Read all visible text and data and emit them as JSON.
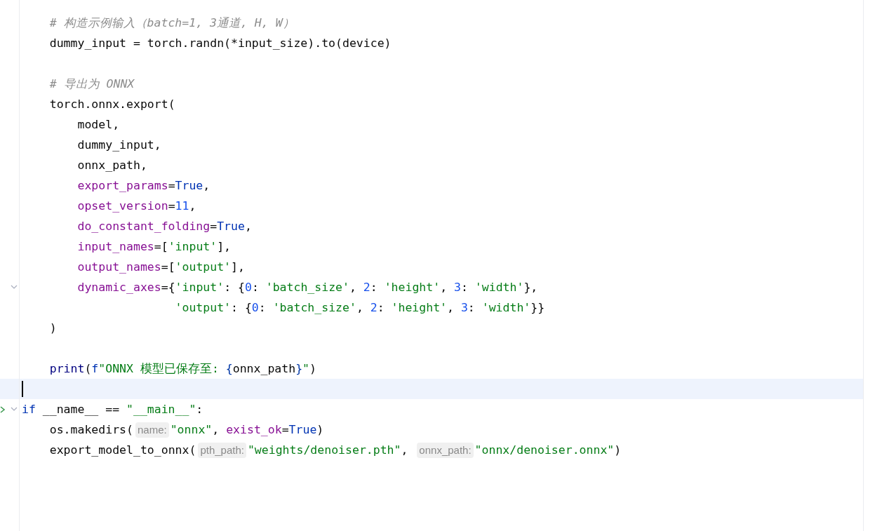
{
  "lines": [
    {
      "fold": false,
      "run": false,
      "current": false,
      "tokens": [
        {
          "kind": "comment",
          "text": "    # 构造示例输入（batch=1, 3通道, H, W）"
        }
      ]
    },
    {
      "fold": false,
      "run": false,
      "current": false,
      "tokens": [
        {
          "kind": "plain",
          "text": "    dummy_input = torch.randn(*input_size).to(device)"
        }
      ]
    },
    {
      "fold": false,
      "run": false,
      "current": false
    },
    {
      "fold": false,
      "run": false,
      "current": false,
      "tokens": [
        {
          "kind": "comment",
          "text": "    # 导出为 ONNX"
        }
      ]
    },
    {
      "fold": false,
      "run": false,
      "current": false,
      "tokens": [
        {
          "kind": "plain",
          "text": "    torch.onnx.export("
        }
      ]
    },
    {
      "fold": false,
      "run": false,
      "current": false,
      "tokens": [
        {
          "kind": "plain",
          "text": "        model,"
        }
      ]
    },
    {
      "fold": false,
      "run": false,
      "current": false,
      "tokens": [
        {
          "kind": "plain",
          "text": "        dummy_input,"
        }
      ]
    },
    {
      "fold": false,
      "run": false,
      "current": false,
      "tokens": [
        {
          "kind": "plain",
          "text": "        onnx_path,"
        }
      ]
    },
    {
      "fold": false,
      "run": false,
      "current": false,
      "tokens": [
        {
          "kind": "param",
          "text": "        export_params"
        },
        {
          "kind": "plain",
          "text": "="
        },
        {
          "kind": "keyword",
          "text": "True"
        },
        {
          "kind": "plain",
          "text": ","
        }
      ]
    },
    {
      "fold": false,
      "run": false,
      "current": false,
      "tokens": [
        {
          "kind": "param",
          "text": "        opset_version"
        },
        {
          "kind": "plain",
          "text": "="
        },
        {
          "kind": "number",
          "text": "11"
        },
        {
          "kind": "plain",
          "text": ","
        }
      ]
    },
    {
      "fold": false,
      "run": false,
      "current": false,
      "tokens": [
        {
          "kind": "param",
          "text": "        do_constant_folding"
        },
        {
          "kind": "plain",
          "text": "="
        },
        {
          "kind": "keyword",
          "text": "True"
        },
        {
          "kind": "plain",
          "text": ","
        }
      ]
    },
    {
      "fold": false,
      "run": false,
      "current": false,
      "tokens": [
        {
          "kind": "param",
          "text": "        input_names"
        },
        {
          "kind": "plain",
          "text": "=["
        },
        {
          "kind": "string",
          "text": "'input'"
        },
        {
          "kind": "plain",
          "text": "],"
        }
      ]
    },
    {
      "fold": false,
      "run": false,
      "current": false,
      "tokens": [
        {
          "kind": "param",
          "text": "        output_names"
        },
        {
          "kind": "plain",
          "text": "=["
        },
        {
          "kind": "string",
          "text": "'output'"
        },
        {
          "kind": "plain",
          "text": "],"
        }
      ]
    },
    {
      "fold": true,
      "run": false,
      "current": false,
      "tokens": [
        {
          "kind": "param",
          "text": "        dynamic_axes"
        },
        {
          "kind": "plain",
          "text": "={"
        },
        {
          "kind": "string",
          "text": "'input'"
        },
        {
          "kind": "plain",
          "text": ": {"
        },
        {
          "kind": "number",
          "text": "0"
        },
        {
          "kind": "plain",
          "text": ": "
        },
        {
          "kind": "string",
          "text": "'batch_size'"
        },
        {
          "kind": "plain",
          "text": ", "
        },
        {
          "kind": "number",
          "text": "2"
        },
        {
          "kind": "plain",
          "text": ": "
        },
        {
          "kind": "string",
          "text": "'height'"
        },
        {
          "kind": "plain",
          "text": ", "
        },
        {
          "kind": "number",
          "text": "3"
        },
        {
          "kind": "plain",
          "text": ": "
        },
        {
          "kind": "string",
          "text": "'width'"
        },
        {
          "kind": "plain",
          "text": "},"
        }
      ]
    },
    {
      "fold": false,
      "run": false,
      "current": false,
      "tokens": [
        {
          "kind": "string",
          "text": "                      'output'"
        },
        {
          "kind": "plain",
          "text": ": {"
        },
        {
          "kind": "number",
          "text": "0"
        },
        {
          "kind": "plain",
          "text": ": "
        },
        {
          "kind": "string",
          "text": "'batch_size'"
        },
        {
          "kind": "plain",
          "text": ", "
        },
        {
          "kind": "number",
          "text": "2"
        },
        {
          "kind": "plain",
          "text": ": "
        },
        {
          "kind": "string",
          "text": "'height'"
        },
        {
          "kind": "plain",
          "text": ", "
        },
        {
          "kind": "number",
          "text": "3"
        },
        {
          "kind": "plain",
          "text": ": "
        },
        {
          "kind": "string",
          "text": "'width'"
        },
        {
          "kind": "plain",
          "text": "}}"
        }
      ]
    },
    {
      "fold": false,
      "run": false,
      "current": false,
      "tokens": [
        {
          "kind": "plain",
          "text": "    )"
        }
      ]
    },
    {
      "fold": false,
      "run": false,
      "current": false
    },
    {
      "fold": false,
      "run": false,
      "current": false,
      "tokens": [
        {
          "kind": "builtin",
          "text": "    print"
        },
        {
          "kind": "plain",
          "text": "("
        },
        {
          "kind": "keyword",
          "text": "f"
        },
        {
          "kind": "string",
          "text": "\"ONNX 模型已保存至: "
        },
        {
          "kind": "brace",
          "text": "{"
        },
        {
          "kind": "plain",
          "text": "onnx_path"
        },
        {
          "kind": "brace",
          "text": "}"
        },
        {
          "kind": "string",
          "text": "\""
        },
        {
          "kind": "plain",
          "text": ")"
        }
      ]
    },
    {
      "fold": false,
      "run": false,
      "current": true
    },
    {
      "fold": true,
      "run": true,
      "current": false,
      "tokens": [
        {
          "kind": "keyword",
          "text": "if"
        },
        {
          "kind": "plain",
          "text": " __name__ == "
        },
        {
          "kind": "string",
          "text": "\"__main__\""
        },
        {
          "kind": "plain",
          "text": ":"
        }
      ]
    },
    {
      "fold": false,
      "run": false,
      "current": false,
      "tokens": [
        {
          "kind": "plain",
          "text": "    os.makedirs("
        },
        {
          "kind": "hint",
          "text": "name:"
        },
        {
          "kind": "string",
          "text": "\"onnx\""
        },
        {
          "kind": "plain",
          "text": ", "
        },
        {
          "kind": "param",
          "text": "exist_ok"
        },
        {
          "kind": "plain",
          "text": "="
        },
        {
          "kind": "keyword",
          "text": "True"
        },
        {
          "kind": "plain",
          "text": ")"
        }
      ]
    },
    {
      "fold": false,
      "run": false,
      "current": false,
      "tokens": [
        {
          "kind": "plain",
          "text": "    export_model_to_onnx("
        },
        {
          "kind": "hint",
          "text": "pth_path:"
        },
        {
          "kind": "string",
          "text": "\"weights/denoiser.pth\""
        },
        {
          "kind": "plain",
          "text": ", "
        },
        {
          "kind": "hint",
          "text": "onnx_path:"
        },
        {
          "kind": "string",
          "text": "\"onnx/denoiser.onnx\""
        },
        {
          "kind": "plain",
          "text": ")"
        }
      ]
    }
  ]
}
